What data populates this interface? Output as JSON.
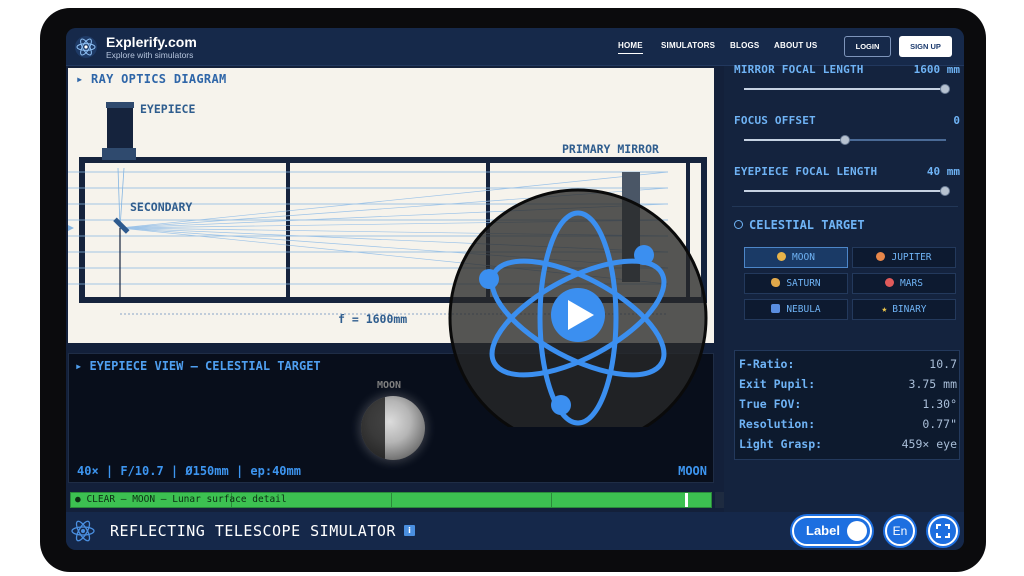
{
  "nav": {
    "brand": "Explerify.com",
    "tagline": "Explore with simulators",
    "links": [
      "HOME",
      "SIMULATORS",
      "BLOGS",
      "ABOUT US"
    ],
    "active_link": "HOME",
    "login": "LOGIN",
    "signup": "SIGN UP"
  },
  "ray": {
    "title": "▸ RAY OPTICS DIAGRAM",
    "eyepiece": "EYEPIECE",
    "primary": "PRIMARY MIRROR",
    "secondary": "SECONDARY",
    "focal": "f = 1600mm"
  },
  "eyeview": {
    "title": "▸ EYEPIECE VIEW — CELESTIAL TARGET",
    "moon_label": "MOON",
    "stats": "40× | F/10.7 | Ø150mm | ep:40mm",
    "target": "MOON",
    "status": "● CLEAR  —  MOON  —  Lunar surface detail",
    "percent": "96%",
    "percent_value": 96
  },
  "controls": {
    "sliders": [
      {
        "label": "MIRROR FOCAL LENGTH",
        "value": "1600 mm",
        "fraction": 1.0
      },
      {
        "label": "FOCUS OFFSET",
        "value": "0",
        "fraction": 0.5
      },
      {
        "label": "EYEPIECE FOCAL LENGTH",
        "value": "40 mm",
        "fraction": 1.0
      }
    ],
    "target_heading": "CELESTIAL TARGET",
    "targets": [
      {
        "label": "MOON",
        "icon": "moon-icon",
        "color": "#e8b44a",
        "active": true
      },
      {
        "label": "JUPITER",
        "icon": "jupiter-icon",
        "color": "#e8874a",
        "active": false
      },
      {
        "label": "SATURN",
        "icon": "saturn-icon",
        "color": "#e0a84a",
        "active": false
      },
      {
        "label": "MARS",
        "icon": "mars-icon",
        "color": "#e05a5a",
        "active": false
      },
      {
        "label": "NEBULA",
        "icon": "nebula-icon",
        "color": "#5a8ee0",
        "active": false
      },
      {
        "label": "BINARY",
        "icon": "star-icon",
        "color": "#f0c84a",
        "active": false
      }
    ],
    "stats": [
      {
        "k": "F-Ratio:",
        "v": "10.7"
      },
      {
        "k": "Exit Pupil:",
        "v": "3.75 mm"
      },
      {
        "k": "True FOV:",
        "v": "1.30°"
      },
      {
        "k": "Resolution:",
        "v": "0.77\""
      },
      {
        "k": "Light Grasp:",
        "v": "459× eye"
      }
    ]
  },
  "bottom": {
    "title": "REFLECTING TELESCOPE SIMULATOR",
    "info": "i",
    "label_toggle": "Label",
    "lang": "En"
  },
  "colors": {
    "accent": "#1d6fe0",
    "panel_text": "#6fb3f5",
    "status_green": "#3cc151"
  }
}
